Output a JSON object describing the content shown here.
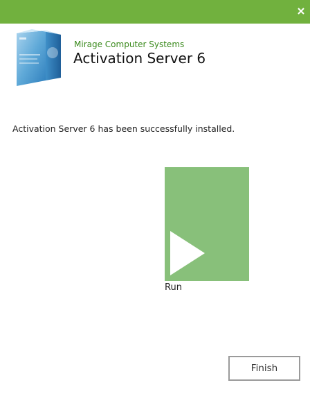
{
  "window": {
    "titlebar_color": "#71b13e",
    "close_icon": "close-icon"
  },
  "header": {
    "vendor": "Mirage Computer Systems",
    "product_title": "Activation Server 6",
    "vendor_color": "#3a8a1c",
    "product_image": "product-box-image"
  },
  "main": {
    "message": "Activation Server 6 has been successfully installed.",
    "run_tile": {
      "label": "Run",
      "color": "#88c07a",
      "icon": "play-icon"
    }
  },
  "footer": {
    "finish_label": "Finish"
  }
}
